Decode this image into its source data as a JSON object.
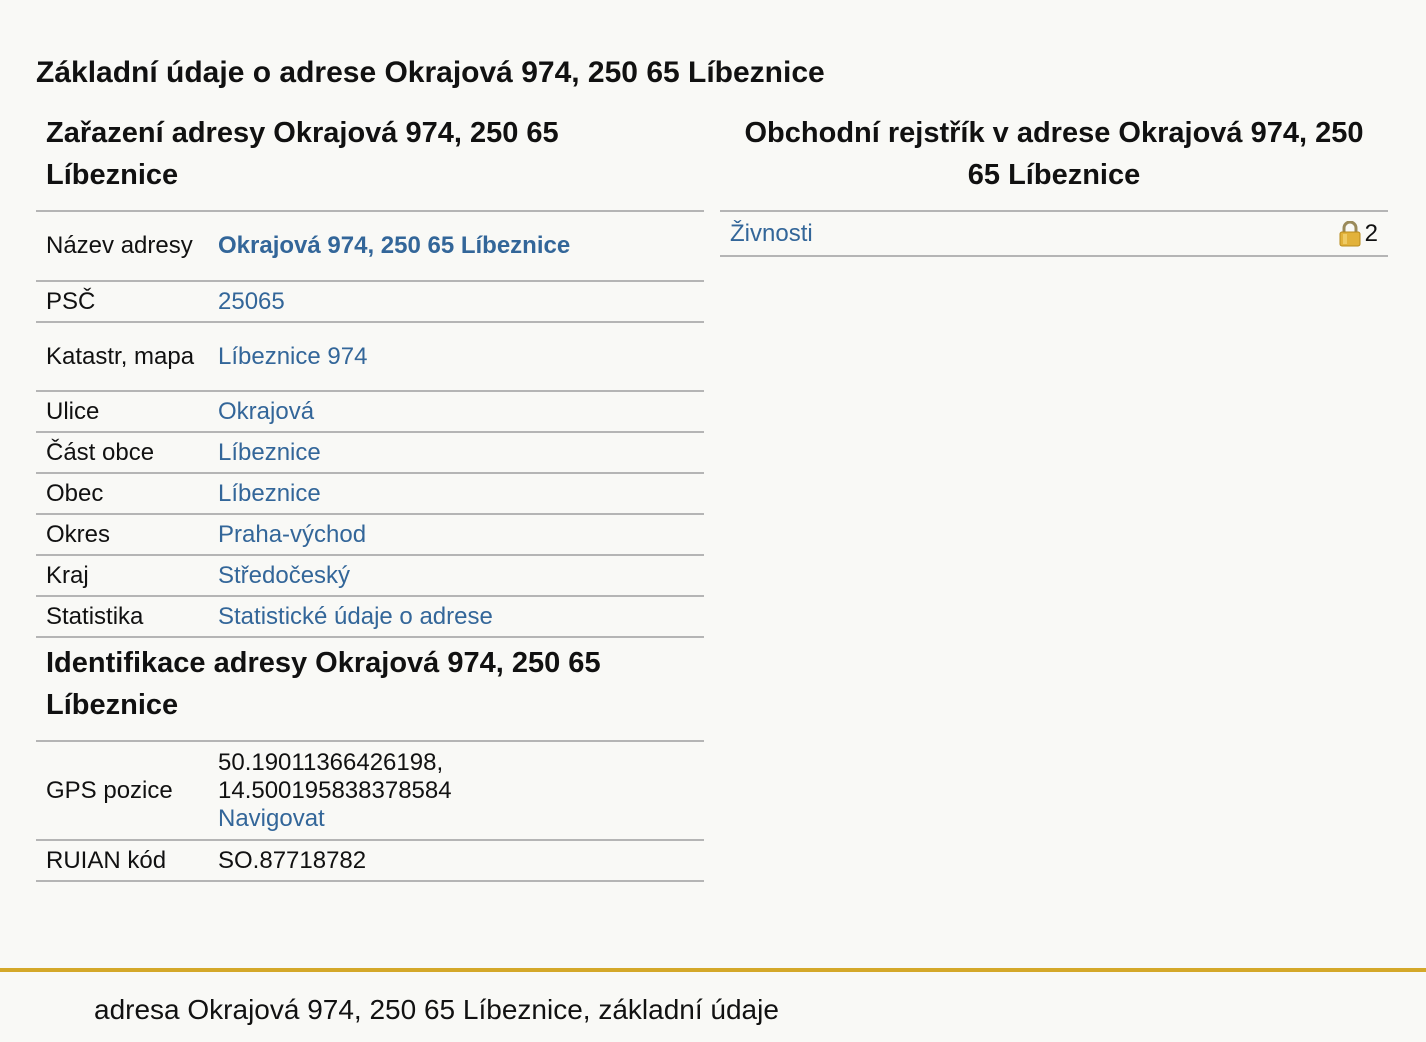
{
  "page_title": "Základní údaje o adrese Okrajová 974, 250 65 Líbeznice",
  "zarazeni": {
    "heading": "Zařazení adresy Okrajová 974, 250 65 Líbeznice",
    "rows": [
      {
        "label": "Název adresy",
        "value": "Okrajová 974, 250 65 Líbeznice"
      },
      {
        "label": "PSČ",
        "value": "25065"
      },
      {
        "label": "Katastr, mapa",
        "value": "Líbeznice 974"
      },
      {
        "label": "Ulice",
        "value": "Okrajová"
      },
      {
        "label": "Část obce",
        "value": "Líbeznice"
      },
      {
        "label": "Obec",
        "value": "Líbeznice"
      },
      {
        "label": "Okres",
        "value": "Praha-východ"
      },
      {
        "label": "Kraj",
        "value": "Středočeský"
      },
      {
        "label": "Statistika",
        "value": "Statistické údaje o adrese"
      }
    ]
  },
  "identifikace": {
    "heading": "Identifikace adresy Okrajová 974, 250 65 Líbeznice",
    "gps_label": "GPS pozice",
    "gps_lat": "50.19011366426198,",
    "gps_lon": "14.500195838378584",
    "navigate_link": "Navigovat",
    "ruian_label": "RUIAN kód",
    "ruian_value": "SO.87718782"
  },
  "rejstrik": {
    "heading": "Obchodní rejstřík v adrese Okrajová 974, 250 65 Líbeznice",
    "items": [
      {
        "label": "Živnosti",
        "count": "2"
      }
    ]
  },
  "footer": {
    "text": "adresa Okrajová 974, 250 65 Líbeznice, základní údaje"
  },
  "colors": {
    "link": "#336699",
    "footer_border": "#d4a829",
    "background": "#f9f9f6"
  }
}
